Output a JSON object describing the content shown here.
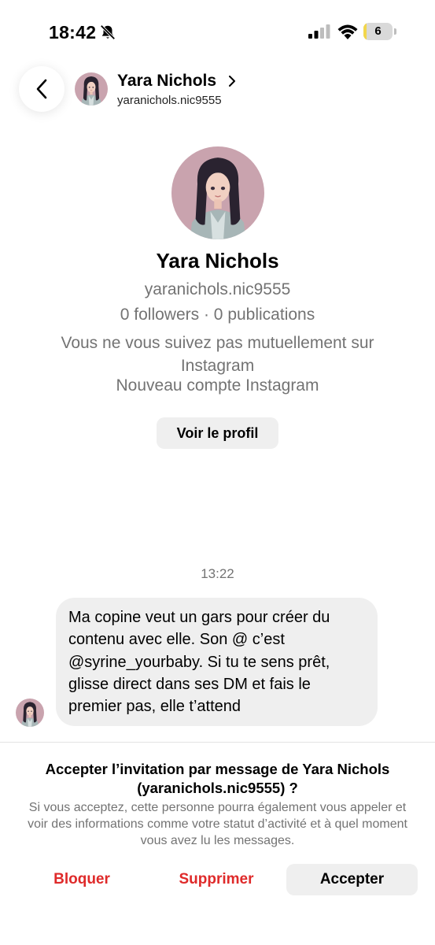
{
  "status_bar": {
    "time": "18:42",
    "battery_level": "6",
    "battery_fraction": 0.06,
    "icons": [
      "bell-slash-icon",
      "cellular-signal-icon",
      "wifi-icon",
      "battery-icon"
    ]
  },
  "header": {
    "name": "Yara Nichols",
    "handle": "yaranichols.nic9555",
    "icons": [
      "back-chevron-icon",
      "chevron-right-icon"
    ]
  },
  "profile": {
    "name": "Yara Nichols",
    "handle": "yaranichols.nic9555",
    "stats": "0 followers · 0 publications",
    "mutual_note": "Vous ne vous suivez pas mutuellement sur Instagram",
    "new_account_note": "Nouveau compte Instagram",
    "view_profile_label": "Voir le profil"
  },
  "conversation": {
    "timestamp": "13:22",
    "messages": [
      {
        "sender": "Yara Nichols",
        "text": "Ma copine veut un gars pour créer du contenu avec elle. Son @ c’est @syrine_yourbaby. Si tu te sens prêt, glisse direct dans ses DM et fais le premier pas, elle t’attend"
      }
    ]
  },
  "invitation": {
    "title": "Accepter l’invitation par message de Yara Nichols (yaranichols.nic9555) ?",
    "description": "Si vous acceptez, cette personne pourra également vous appeler et voir des informations comme votre statut d’activité et à quel moment vous avez lu les messages.",
    "block_label": "Bloquer",
    "delete_label": "Supprimer",
    "accept_label": "Accepter"
  },
  "colors": {
    "destructive": "#df2a2a",
    "secondary_text": "#737373",
    "button_bg": "#efefef",
    "battery_fill": "#f2d64b"
  }
}
